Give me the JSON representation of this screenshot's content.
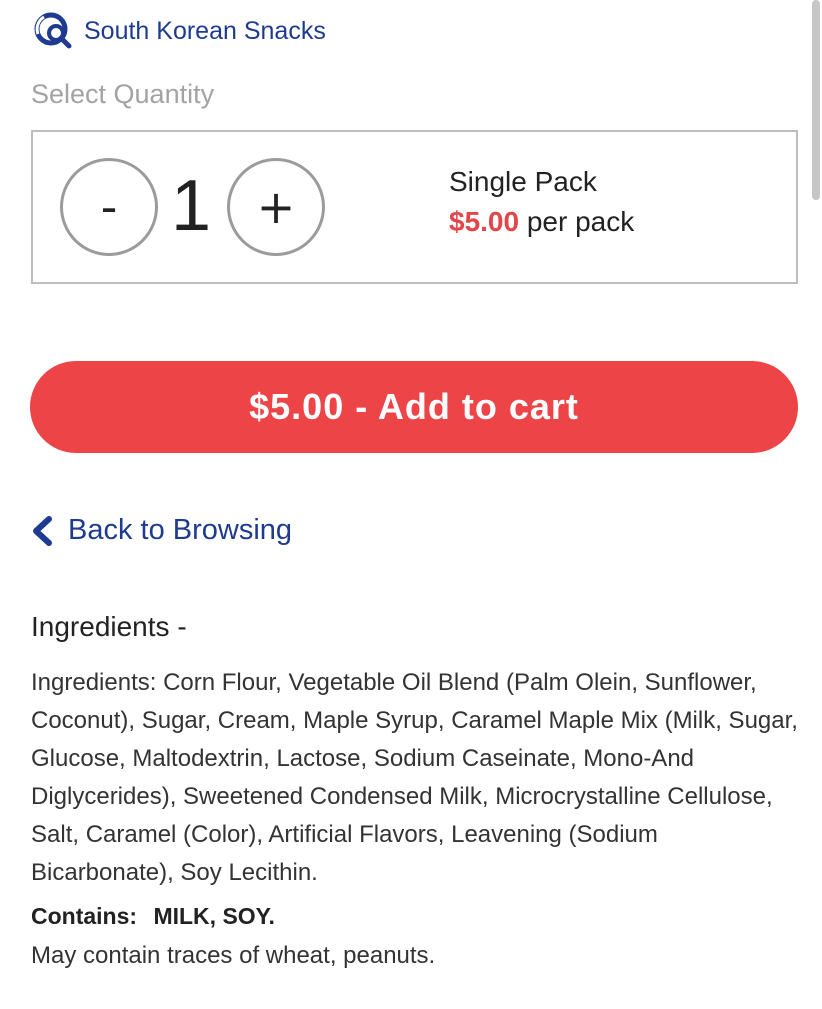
{
  "category": {
    "label": "South Korean Snacks",
    "icon": "category-search-icon",
    "color": "#1f3b8f"
  },
  "quantity": {
    "section_label": "Select Quantity",
    "value": "1",
    "minus_label": "-",
    "plus_label": "+",
    "pack_name": "Single Pack",
    "pack_price": "$5.00",
    "pack_unit": "per pack"
  },
  "cart": {
    "button_label": "$5.00 - Add to cart",
    "color": "#ed4448"
  },
  "navigation": {
    "back_label": "Back to Browsing",
    "back_icon": "chevron-left-icon"
  },
  "ingredients": {
    "heading": "Ingredients -",
    "text": "Ingredients: Corn Flour, Vegetable Oil Blend (Palm Olein, Sunflower, Coconut), Sugar, Cream, Maple Syrup, Caramel Maple Mix (Milk, Sugar, Glucose, Maltodextrin, Lactose, Sodium Caseinate, Mono-And Diglycerides), Sweetened Condensed Milk, Microcrystalline Cellulose, Salt, Caramel (Color), Artificial Flavors, Leavening (Sodium Bicarbonate), Soy Lecithin.",
    "contains_label": "Contains:",
    "contains_value": "MILK, SOY.",
    "traces": "May contain traces of wheat, peanuts."
  },
  "colors": {
    "price_red": "#e4454a",
    "link_blue": "#1f3b8f"
  }
}
